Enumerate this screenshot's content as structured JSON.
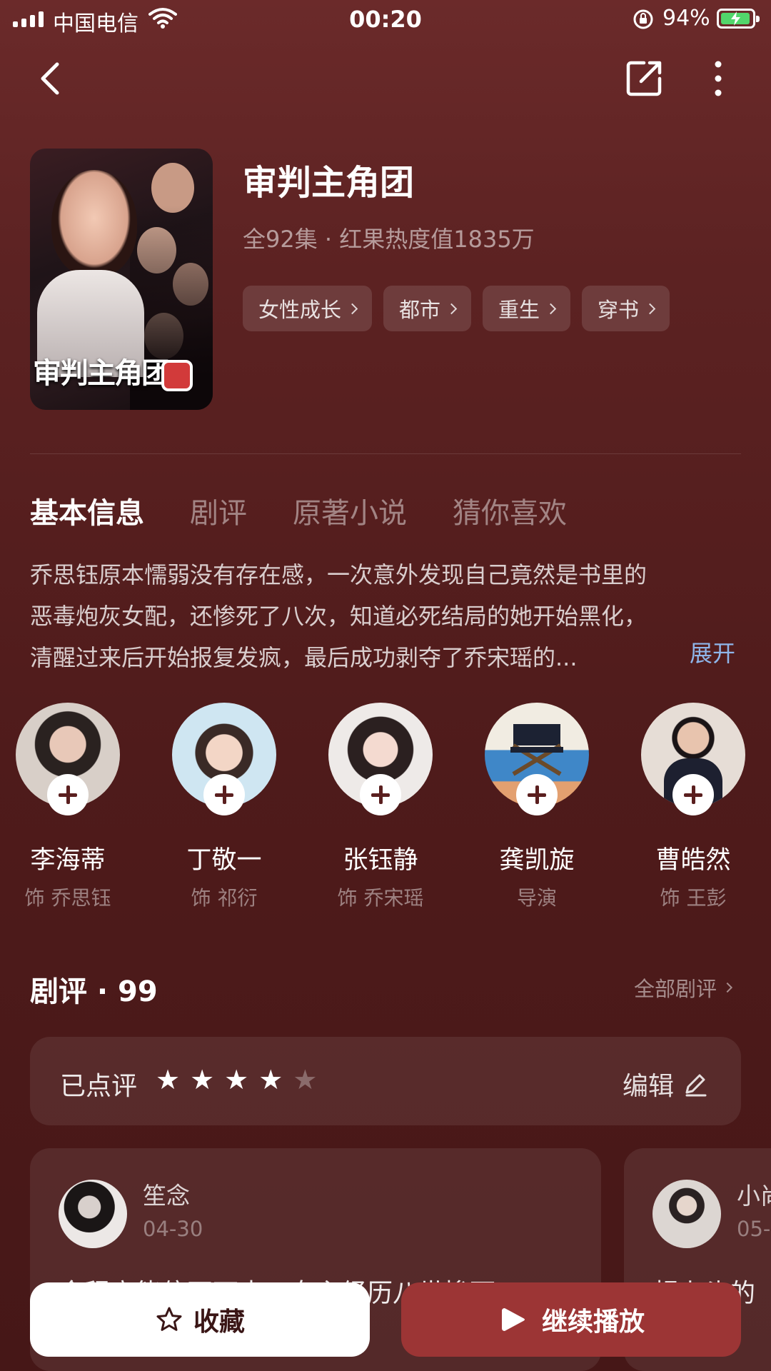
{
  "status_bar": {
    "carrier": "中国电信",
    "time": "00:20",
    "battery_percent": "94%"
  },
  "drama": {
    "title": "审判主角团",
    "meta": "全92集 · 红果热度值1835万",
    "poster_title": "审判主角团",
    "tags": [
      "女性成长",
      "都市",
      "重生",
      "穿书"
    ]
  },
  "tabs": [
    "基本信息",
    "剧评",
    "原著小说",
    "猜你喜欢"
  ],
  "description": {
    "lines": [
      "乔思钰原本懦弱没有存在感，一次意外发现自己竟然是书里的",
      "恶毒炮灰女配，还惨死了八次，知道必死结局的她开始黑化，",
      "清醒过来后开始报复发疯，最后成功剥夺了乔宋瑶的..."
    ],
    "expand_label": "展开"
  },
  "cast": [
    {
      "name": "李海蒂",
      "role": "饰 乔思钰"
    },
    {
      "name": "丁敬一",
      "role": "饰 祁衍"
    },
    {
      "name": "张钰静",
      "role": "饰 乔宋瑶"
    },
    {
      "name": "龚凯旋",
      "role": "导演"
    },
    {
      "name": "曹皓然",
      "role": "饰 王彭"
    }
  ],
  "reviews": {
    "title": "剧评 · 99",
    "all_label": "全部剧评",
    "rated_label": "已点评",
    "rating": 4,
    "rating_max": 5,
    "edit_label": "编辑",
    "cards": [
      {
        "user": "笙念",
        "date": "04-30",
        "text": "全程高能停不下来！女主经历八世惨死"
      },
      {
        "user": "小尚",
        "date": "05-",
        "text": "超上头的"
      }
    ]
  },
  "actions": {
    "favorite_label": "收藏",
    "play_label": "继续播放"
  },
  "colors": {
    "background": "#5c2222",
    "play_button": "#9c3535",
    "expand_link": "#8fb6ea",
    "battery_fill": "#52d66b"
  }
}
